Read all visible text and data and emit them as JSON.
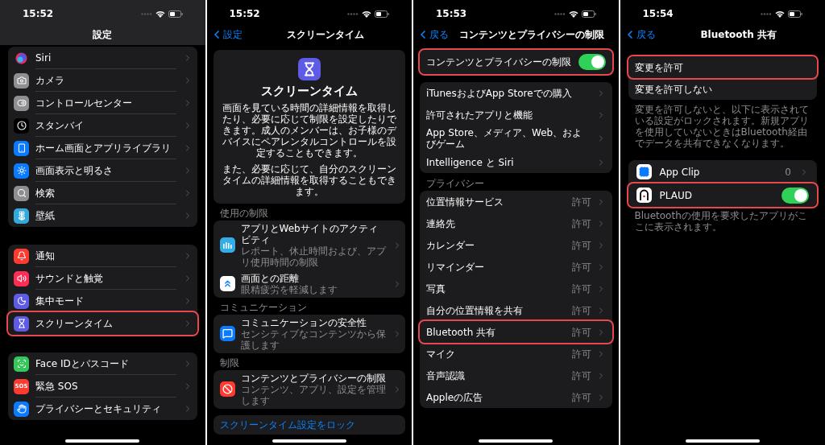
{
  "screens": [
    {
      "kind": "settings",
      "time": "15:52",
      "title": "設定",
      "groups": [
        {
          "rows": [
            {
              "label": "Siri",
              "color": "#1c1c1e",
              "highlighted": false
            },
            {
              "label": "カメラ",
              "color": "#8e8e93",
              "highlighted": false
            },
            {
              "label": "コントロールセンター",
              "color": "#8e8e93",
              "highlighted": false
            },
            {
              "label": "スタンバイ",
              "color": "#000000",
              "highlighted": false
            },
            {
              "label": "ホーム画面とアプリライブラリ",
              "color": "#0a7aff",
              "highlighted": false
            },
            {
              "label": "画面表示と明るさ",
              "color": "#0a7aff",
              "highlighted": false
            },
            {
              "label": "検索",
              "color": "#8e8e93",
              "highlighted": false
            },
            {
              "label": "壁紙",
              "color": "#34aadc",
              "highlighted": false
            }
          ]
        },
        {
          "rows": [
            {
              "label": "通知",
              "color": "#ff3b30",
              "highlighted": false
            },
            {
              "label": "サウンドと触覚",
              "color": "#ff2d55",
              "highlighted": false
            },
            {
              "label": "集中モード",
              "color": "#5e5ce6",
              "highlighted": false
            },
            {
              "label": "スクリーンタイム",
              "color": "#5e5ce6",
              "highlighted": true
            }
          ]
        },
        {
          "rows": [
            {
              "label": "Face IDとパスコード",
              "color": "#34c759",
              "highlighted": false
            },
            {
              "label": "緊急 SOS",
              "color": "#ff3b30",
              "badge": "SOS",
              "highlighted": false
            },
            {
              "label": "プライバシーとセキュリティ",
              "color": "#0a7aff",
              "highlighted": false
            }
          ]
        }
      ]
    },
    {
      "kind": "screen_time",
      "time": "15:52",
      "back": "設定",
      "title": "スクリーンタイム",
      "hero": {
        "title": "スクリーンタイム",
        "paragraphs": [
          "画面を見ている時間の詳細情報を取得したり、必要に応じて制限を設定したりできます。成人のメンバーは、お子様のデバイスにペアレンタルコントロールを設定することもできます。",
          "また、必要に応じて、自分のスクリーンタイムの詳細情報を取得することもできます。"
        ]
      },
      "sections": [
        {
          "header": "使用の制限",
          "rows": [
            {
              "label": "アプリとWebサイトのアクティビティ",
              "detail": "レポート、休止時間および、アプリ使用時間の制限",
              "color": "#32ade6"
            },
            {
              "label": "画面との距離",
              "detail": "眼精疲労を軽減します",
              "color": "#ffffff"
            }
          ]
        },
        {
          "header": "コミュニケーション",
          "rows": [
            {
              "label": "コミュニケーションの安全性",
              "detail": "センシティブなコンテンツから保護します",
              "color": "#0a7aff"
            }
          ]
        },
        {
          "header": "制限",
          "rows": [
            {
              "label": "コンテンツとプライバシーの制限",
              "detail": "コンテンツ、アプリ、設定を管理します",
              "color": "#ff3b30"
            }
          ]
        }
      ],
      "link": "スクリーンタイム設定をロック"
    },
    {
      "kind": "content_privacy",
      "time": "15:53",
      "back": "戻る",
      "title": "コンテンツとプライバシーの制限",
      "master": {
        "label": "コンテンツとプライバシーの制限",
        "on": true,
        "highlighted": true
      },
      "sections": [
        {
          "rows": [
            {
              "label": "iTunesおよびApp Storeでの購入",
              "highlighted": false
            },
            {
              "label": "許可されたアプリと機能",
              "highlighted": false
            },
            {
              "label": "App Store、メディア、Web、およびゲーム",
              "highlighted": false
            },
            {
              "label": "Intelligence と Siri",
              "highlighted": false
            }
          ]
        },
        {
          "header": "プライバシー",
          "rows": [
            {
              "label": "位置情報サービス",
              "value": "許可",
              "highlighted": false
            },
            {
              "label": "連絡先",
              "value": "許可",
              "highlighted": false
            },
            {
              "label": "カレンダー",
              "value": "許可",
              "highlighted": false
            },
            {
              "label": "リマインダー",
              "value": "許可",
              "highlighted": false
            },
            {
              "label": "写真",
              "value": "許可",
              "highlighted": false
            },
            {
              "label": "自分の位置情報を共有",
              "value": "許可",
              "highlighted": false
            },
            {
              "label": "Bluetooth 共有",
              "value": "許可",
              "highlighted": true
            },
            {
              "label": "マイク",
              "value": "許可",
              "highlighted": false
            },
            {
              "label": "音声認識",
              "value": "許可",
              "highlighted": false
            },
            {
              "label": "Appleの広告",
              "value": "許可",
              "highlighted": false
            }
          ]
        }
      ]
    },
    {
      "kind": "bluetooth",
      "time": "15:54",
      "back": "戻る",
      "title": "Bluetooth 共有",
      "options": [
        {
          "label": "変更を許可",
          "highlighted": true
        },
        {
          "label": "変更を許可しない",
          "highlighted": false
        }
      ],
      "note": "変更を許可しないと、以下に表示されている設定がロックされます。新規アプリを使用していないときはBluetooth経由でデータを共有できなくなります。",
      "apps": [
        {
          "kind": "count",
          "label": "App Clip",
          "value": "0",
          "highlighted": false
        },
        {
          "kind": "switch",
          "label": "PLAUD",
          "on": true,
          "highlighted": true
        }
      ],
      "footer": "Bluetoothの使用を要求したアプリがここに表示されます。"
    }
  ]
}
